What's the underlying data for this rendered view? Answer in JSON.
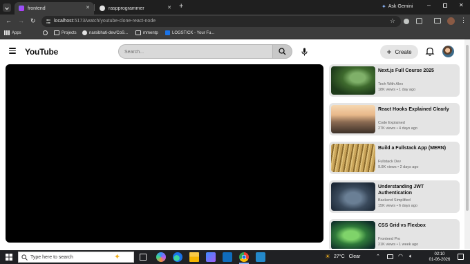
{
  "browser": {
    "tabs": [
      {
        "label": "frontend",
        "active": true
      },
      {
        "label": "raspprogrammer",
        "active": false
      }
    ],
    "new_tab": "+",
    "ask_gemini": "Ask Gemini",
    "url_host": "localhost",
    "url_path": ":5173/watch/youtube-clone-react-node",
    "bookmarks": [
      {
        "label": "Apps"
      },
      {
        "label": ""
      },
      {
        "label": "Projects"
      },
      {
        "label": "narsibhati-dev/CoS..."
      },
      {
        "label": "mmentp"
      },
      {
        "label": "LOGSTICK - Your Fu..."
      }
    ]
  },
  "header": {
    "logo": "YouTube",
    "search_placeholder": "Search...",
    "create_label": "Create"
  },
  "recommendations": [
    {
      "title": "Next.js Full Course 2025",
      "channel": "Tech With Alex",
      "meta": "18K views • 1 day ago",
      "thumb": "forest"
    },
    {
      "title": "React Hooks Explained Clearly",
      "channel": "Code Explained",
      "meta": "27K views • 4 days ago",
      "thumb": "cliff"
    },
    {
      "title": "Build a Fullstack App (MERN)",
      "channel": "Fullstack Dev",
      "meta": "9.8K views • 2 days ago",
      "thumb": "grass"
    },
    {
      "title": "Understanding JWT Authentication",
      "channel": "Backend Simplified",
      "meta": "15K views • 6 days ago",
      "thumb": "person"
    },
    {
      "title": "CSS Grid vs Flexbox",
      "channel": "Frontend Pro",
      "meta": "21K views • 1 week ago",
      "thumb": "plant"
    }
  ],
  "taskbar": {
    "search_placeholder": "Type here to search",
    "weather_temp": "27°C",
    "weather_text": "Clear",
    "time": "02:10",
    "date": "01-06-2026"
  },
  "colors": {
    "accent": "#0f0f0f",
    "card_bg": "#e4e4e4",
    "chrome_dark": "#1f1f1f"
  }
}
